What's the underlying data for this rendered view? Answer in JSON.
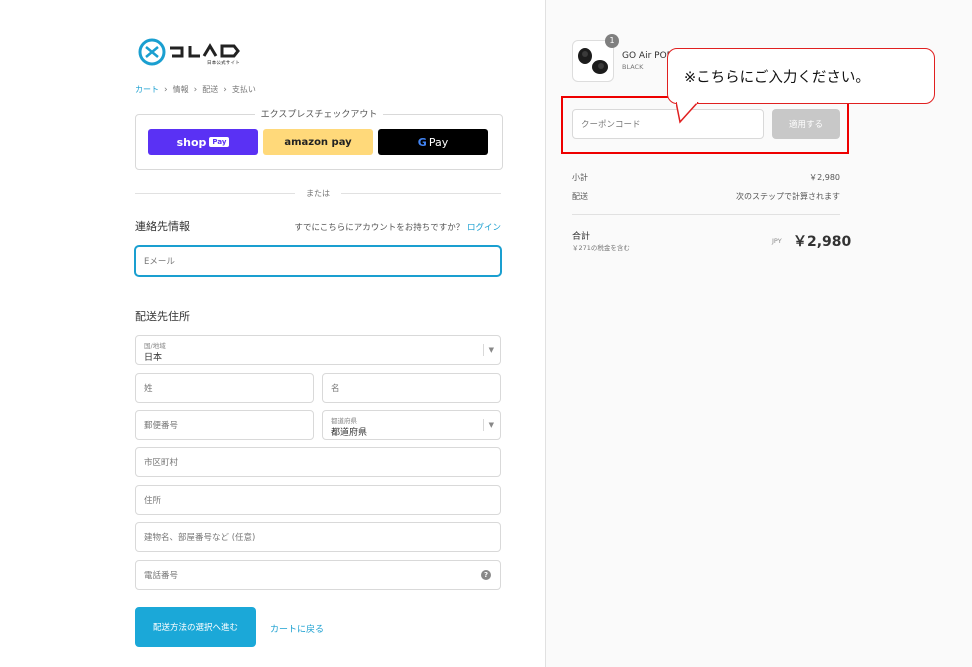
{
  "brand": {
    "logo_text": "JLAB",
    "subtitle": "日本公式サイト"
  },
  "breadcrumb": [
    {
      "label": "カート",
      "active": true
    },
    {
      "label": "情報",
      "active": false
    },
    {
      "label": "配送",
      "active": false
    },
    {
      "label": "支払い",
      "active": false
    }
  ],
  "express": {
    "title": "エクスプレスチェックアウト",
    "shop_pay": "shop",
    "shop_pay_badge": "Pay",
    "amazon_pay": "amazon pay",
    "google_pay": "Pay",
    "google_g": "G"
  },
  "divider_text": "または",
  "contact": {
    "heading": "連絡先情報",
    "account_text": "すでにこちらにアカウントをお持ちですか？",
    "login_label": "ログイン",
    "email_placeholder": "Eメール"
  },
  "shipping": {
    "heading": "配送先住所",
    "country_label": "国/地域",
    "country_value": "日本",
    "last_name_placeholder": "姓",
    "first_name_placeholder": "名",
    "postal_placeholder": "郵便番号",
    "prefecture_label": "都道府県",
    "prefecture_value": "都道府県",
    "city_placeholder": "市区町村",
    "address_placeholder": "住所",
    "building_placeholder": "建物名、部屋番号など (任意)",
    "phone_placeholder": "電話番号",
    "help_icon": "?"
  },
  "actions": {
    "continue_label": "配送方法の選択へ進む",
    "back_label": "カートに戻る"
  },
  "summary": {
    "product_name": "GO Air POP",
    "product_variant": "BLACK",
    "quantity": "1",
    "coupon_placeholder": "クーポンコード",
    "apply_label": "適用する",
    "subtotal_label": "小計",
    "subtotal_value": "￥2,980",
    "shipping_label": "配送",
    "shipping_value": "次のステップで計算されます",
    "total_label": "合計",
    "tax_note": "￥271の税金を含む",
    "currency": "JPY",
    "total_value": "￥2,980"
  },
  "callout": {
    "text": "※こちらにご入力ください。"
  },
  "colors": {
    "accent": "#1a9fd0",
    "highlight": "#e00000",
    "shop_pay": "#5a31f4",
    "amazon_pay": "#ffd97a"
  }
}
